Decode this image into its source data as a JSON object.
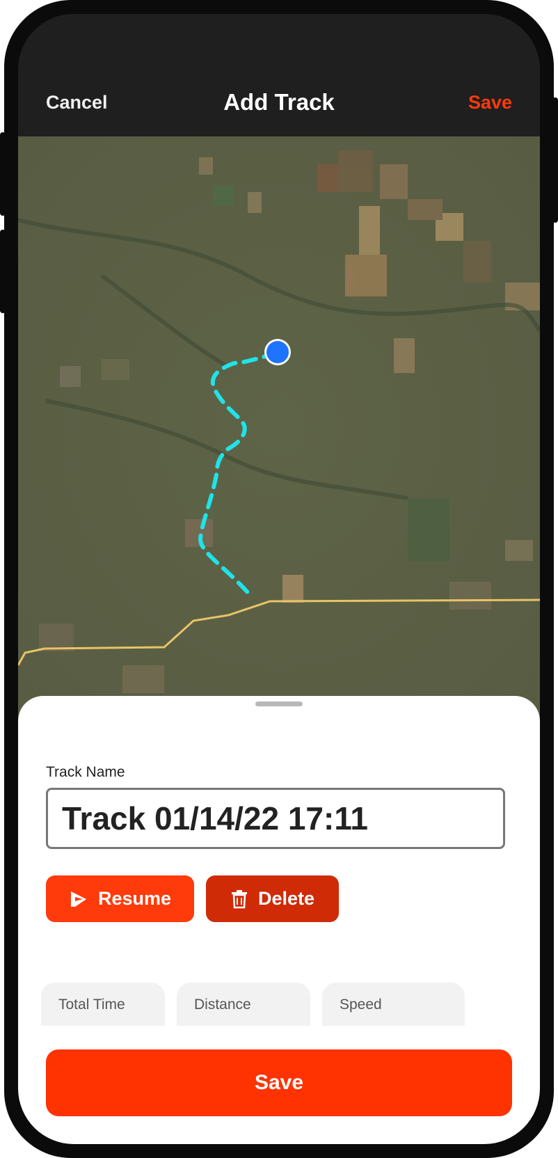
{
  "header": {
    "cancel_label": "Cancel",
    "title": "Add Track",
    "save_label": "Save"
  },
  "track": {
    "name_label": "Track Name",
    "name_value": "Track 01/14/22 17:11"
  },
  "actions": {
    "resume_label": "Resume",
    "delete_label": "Delete"
  },
  "stats": [
    {
      "label": "Total Time",
      "value": ""
    },
    {
      "label": "Distance",
      "value": ""
    },
    {
      "label": "Speed",
      "value": ""
    }
  ],
  "footer": {
    "save_label": "Save"
  },
  "colors": {
    "accent": "#ff3302",
    "delete": "#cf2b07",
    "track_line": "#1fe3e8",
    "location_dot": "#1e73ff",
    "road": "#e8c368",
    "navbar": "#1f1f1f"
  },
  "icons": {
    "resume": "resume-play-icon",
    "delete": "trash-icon",
    "location": "current-location-icon"
  }
}
